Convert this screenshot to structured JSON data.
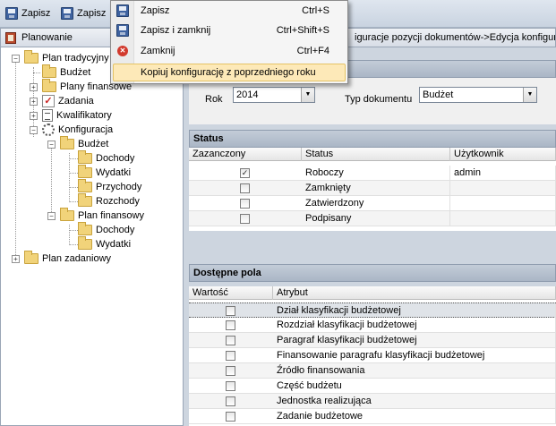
{
  "toolbar": {
    "save_label": "Zapisz",
    "save_close_label": "Zapisz"
  },
  "menu": {
    "items": [
      {
        "label": "Zapisz",
        "shortcut": "Ctrl+S"
      },
      {
        "label": "Zapisz i zamknij",
        "shortcut": "Ctrl+Shift+S"
      },
      {
        "label": "Zamknij",
        "shortcut": "Ctrl+F4"
      },
      {
        "label": "Kopiuj konfigurację z poprzedniego roku",
        "shortcut": ""
      }
    ]
  },
  "left": {
    "header": "Planowanie",
    "tree": [
      {
        "label": "Plan tradycyjny"
      },
      {
        "label": "Budżet"
      },
      {
        "label": "Plany finansowe"
      },
      {
        "label": "Zadania"
      },
      {
        "label": "Kwalifikatory"
      },
      {
        "label": "Konfiguracja"
      },
      {
        "label": "Budżet"
      },
      {
        "label": "Dochody"
      },
      {
        "label": "Wydatki"
      },
      {
        "label": "Przychody"
      },
      {
        "label": "Rozchody"
      },
      {
        "label": "Plan finansowy"
      },
      {
        "label": "Dochody"
      },
      {
        "label": "Wydatki"
      },
      {
        "label": "Plan zadaniowy"
      }
    ]
  },
  "right": {
    "breadcrumb": "iguracje pozycji dokumentów->Edycja konfigurac",
    "filter": {
      "year_label": "Rok",
      "year_value": "2014",
      "doc_type_label": "Typ dokumentu",
      "doc_type_value": "Budżet"
    },
    "status": {
      "title": "Status",
      "columns": [
        "Zazanczony",
        "Status",
        "Użytkownik"
      ],
      "rows": [
        {
          "checked": "✓",
          "status": "Roboczy",
          "user": "admin"
        },
        {
          "checked": "",
          "status": "Zamknięty",
          "user": ""
        },
        {
          "checked": "",
          "status": "Zatwierdzony",
          "user": ""
        },
        {
          "checked": "",
          "status": "Podpisany",
          "user": ""
        }
      ]
    },
    "fields": {
      "title": "Dostępne pola",
      "columns": [
        "Wartość",
        "Atrybut"
      ],
      "rows": [
        {
          "attr": "Dział klasyfikacji budżetowej"
        },
        {
          "attr": "Rozdział klasyfikacji budżetowej"
        },
        {
          "attr": "Paragraf klasyfikacji budżetowej"
        },
        {
          "attr": "Finansowanie paragrafu klasyfikacji budżetowej"
        },
        {
          "attr": "Źródło finansowania"
        },
        {
          "attr": "Część budżetu"
        },
        {
          "attr": "Jednostka realizująca"
        },
        {
          "attr": "Zadanie budżetowe"
        }
      ]
    }
  }
}
